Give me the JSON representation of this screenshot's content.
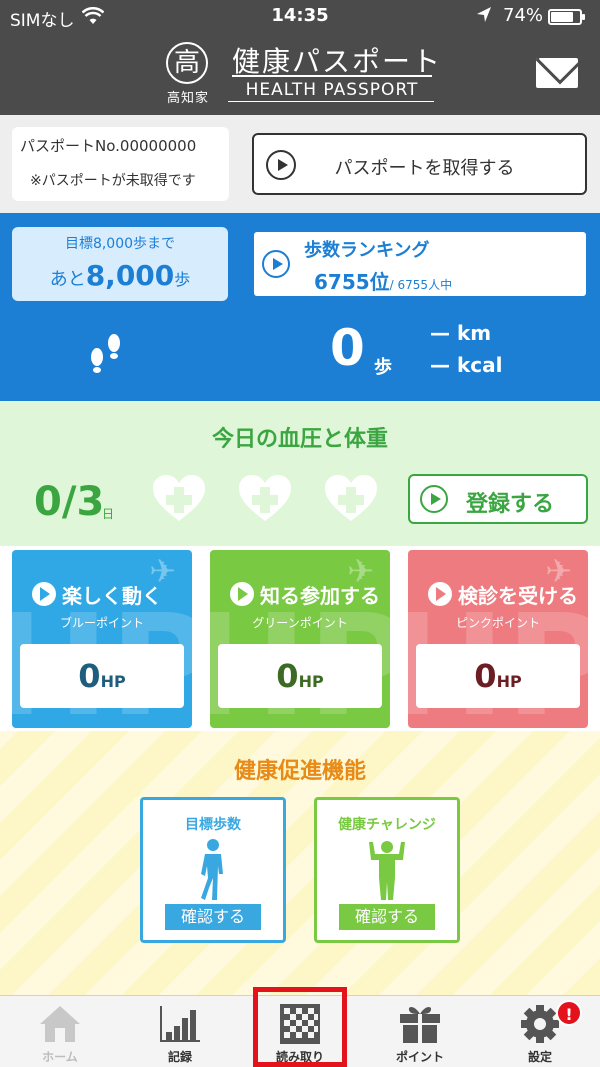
{
  "status_bar": {
    "carrier": "SIMなし",
    "time": "14:35",
    "battery": "74%"
  },
  "header": {
    "logo_char": "高",
    "logo_sub": "高知家",
    "title": "健康パスポート",
    "subtitle": "HEALTH PASSPORT"
  },
  "passport": {
    "number": "パスポートNo.00000000",
    "note": "※パスポートが未取得です",
    "get_button": "パスポートを取得する"
  },
  "steps": {
    "goal_label": "目標8,000歩まで",
    "goal_prefix": "あと",
    "goal_remaining": "8,000",
    "goal_unit": "歩",
    "ranking_title": "歩数ランキング",
    "ranking_position": "6755位",
    "ranking_total": "/ 6755人中",
    "count": "0",
    "count_unit": "歩",
    "distance": "— km",
    "calories": "— kcal"
  },
  "blood_pressure": {
    "title": "今日の血圧と体重",
    "progress": "0/3",
    "progress_unit": "日",
    "register_button": "登録する"
  },
  "point_cards": [
    {
      "title": "楽しく動く",
      "subtitle": "ブルーポイント",
      "value": "0",
      "unit": "HP",
      "color": "#2fa8e5",
      "value_color": "#1f5d7e"
    },
    {
      "title": "知る参加する",
      "subtitle": "グリーンポイント",
      "value": "0",
      "unit": "HP",
      "color": "#7ac943",
      "value_color": "#3d6b24"
    },
    {
      "title": "検診を受ける",
      "subtitle": "ピンクポイント",
      "value": "0",
      "unit": "HP",
      "color": "#ee7b80",
      "value_color": "#6b1f24"
    }
  ],
  "features": {
    "title": "健康促進機能",
    "items": [
      {
        "title": "目標歩数",
        "button": "確認する",
        "color": "#3aa8e0"
      },
      {
        "title": "健康チャレンジ",
        "button": "確認する",
        "color": "#7ac943"
      }
    ]
  },
  "tabbar": {
    "items": [
      {
        "label": "ホーム",
        "icon": "home-icon"
      },
      {
        "label": "記録",
        "icon": "bar-chart-icon"
      },
      {
        "label": "読み取り",
        "icon": "qr-code-icon"
      },
      {
        "label": "ポイント",
        "icon": "gift-icon"
      },
      {
        "label": "設定",
        "icon": "gear-icon"
      }
    ],
    "settings_badge": "!"
  }
}
